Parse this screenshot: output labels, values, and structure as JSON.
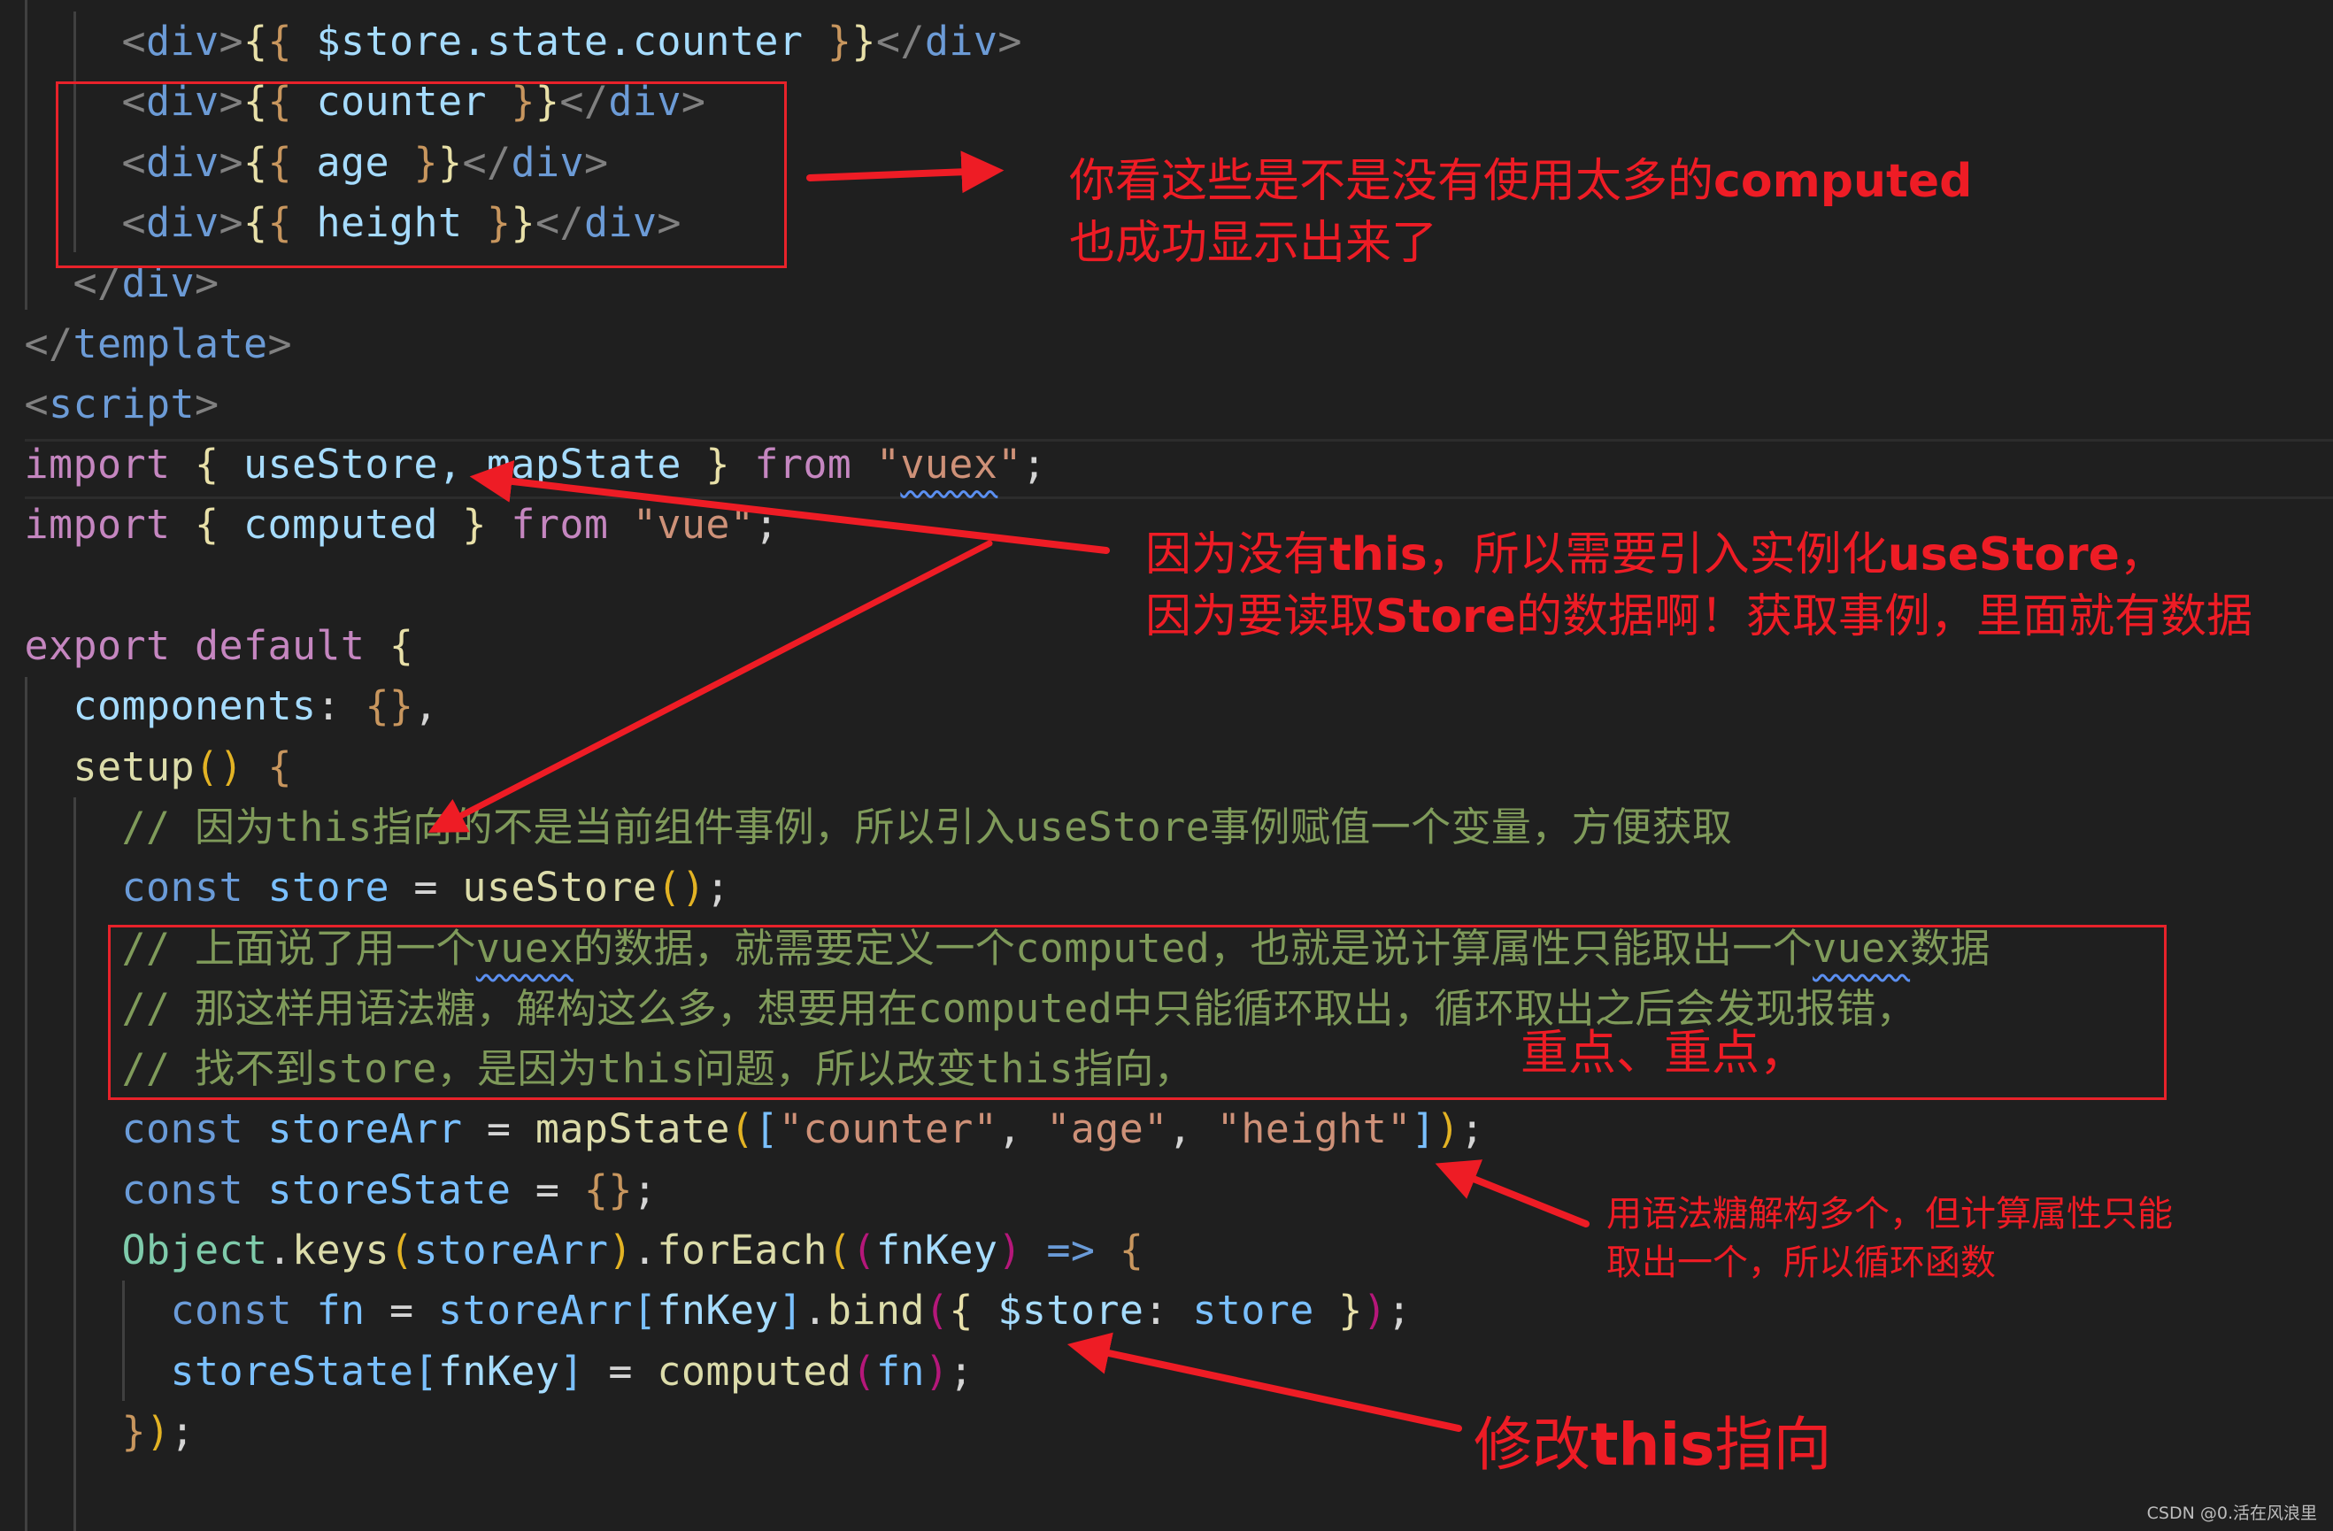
{
  "code": {
    "lines": [
      {
        "indent": 5,
        "tokens": [
          [
            "<",
            "punc"
          ],
          [
            "div",
            "tag"
          ],
          [
            ">",
            "punc"
          ],
          [
            "{",
            "br1"
          ],
          [
            "{",
            "br2"
          ],
          [
            " $store.state.counter ",
            "var"
          ],
          [
            "}",
            "br2"
          ],
          [
            "}",
            "br1"
          ],
          [
            "</",
            "punc"
          ],
          [
            "div",
            "tag"
          ],
          [
            ">",
            "punc"
          ]
        ]
      },
      {
        "indent": 5,
        "tokens": [
          [
            "<",
            "punc"
          ],
          [
            "div",
            "tag"
          ],
          [
            ">",
            "punc"
          ],
          [
            "{",
            "br1"
          ],
          [
            "{",
            "br2"
          ],
          [
            " counter ",
            "var"
          ],
          [
            "}",
            "br2"
          ],
          [
            "}",
            "br1"
          ],
          [
            "</",
            "punc"
          ],
          [
            "div",
            "tag"
          ],
          [
            ">",
            "punc"
          ]
        ]
      },
      {
        "indent": 5,
        "tokens": [
          [
            "<",
            "punc"
          ],
          [
            "div",
            "tag"
          ],
          [
            ">",
            "punc"
          ],
          [
            "{",
            "br1"
          ],
          [
            "{",
            "br2"
          ],
          [
            " age ",
            "var"
          ],
          [
            "}",
            "br2"
          ],
          [
            "}",
            "br1"
          ],
          [
            "</",
            "punc"
          ],
          [
            "div",
            "tag"
          ],
          [
            ">",
            "punc"
          ]
        ]
      },
      {
        "indent": 5,
        "tokens": [
          [
            "<",
            "punc"
          ],
          [
            "div",
            "tag"
          ],
          [
            ">",
            "punc"
          ],
          [
            "{",
            "br1"
          ],
          [
            "{",
            "br2"
          ],
          [
            " height ",
            "var"
          ],
          [
            "}",
            "br2"
          ],
          [
            "}",
            "br1"
          ],
          [
            "</",
            "punc"
          ],
          [
            "div",
            "tag"
          ],
          [
            ">",
            "punc"
          ]
        ]
      },
      {
        "indent": 3,
        "tokens": [
          [
            "</",
            "punc"
          ],
          [
            "div",
            "tag"
          ],
          [
            ">",
            "punc"
          ]
        ]
      },
      {
        "indent": 1,
        "tokens": [
          [
            "</",
            "punc"
          ],
          [
            "template",
            "tag"
          ],
          [
            ">",
            "punc"
          ]
        ]
      },
      {
        "indent": 1,
        "tokens": [
          [
            "<",
            "punc"
          ],
          [
            "script",
            "tag"
          ],
          [
            ">",
            "punc"
          ]
        ]
      },
      {
        "indent": 1,
        "tokens": [
          [
            "import",
            "kw"
          ],
          [
            " ",
            "plain"
          ],
          [
            "{",
            "br1"
          ],
          [
            " useStore, mapState ",
            "var"
          ],
          [
            "}",
            "br1"
          ],
          [
            " ",
            "plain"
          ],
          [
            "from",
            "kw"
          ],
          [
            " ",
            "plain"
          ],
          [
            "\"",
            "str"
          ],
          [
            "vuex",
            "str sq"
          ],
          [
            "\"",
            "str"
          ],
          [
            ";",
            "plain"
          ]
        ]
      },
      {
        "indent": 1,
        "tokens": [
          [
            "import",
            "kw"
          ],
          [
            " ",
            "plain"
          ],
          [
            "{",
            "br1"
          ],
          [
            " computed ",
            "var"
          ],
          [
            "}",
            "br1"
          ],
          [
            " ",
            "plain"
          ],
          [
            "from",
            "kw"
          ],
          [
            " ",
            "plain"
          ],
          [
            "\"vue\"",
            "str"
          ],
          [
            ";",
            "plain"
          ]
        ]
      },
      {
        "indent": 1,
        "tokens": []
      },
      {
        "indent": 1,
        "tokens": [
          [
            "export",
            "kw"
          ],
          [
            " ",
            "plain"
          ],
          [
            "default",
            "kw"
          ],
          [
            " ",
            "plain"
          ],
          [
            "{",
            "br1"
          ]
        ]
      },
      {
        "indent": 3,
        "tokens": [
          [
            "components",
            "var"
          ],
          [
            ": ",
            "plain"
          ],
          [
            "{}",
            "br2"
          ],
          [
            ",",
            "plain"
          ]
        ]
      },
      {
        "indent": 3,
        "tokens": [
          [
            "setup",
            "fn"
          ],
          [
            "(",
            "br3"
          ],
          [
            ")",
            "br3"
          ],
          [
            " ",
            "plain"
          ],
          [
            "{",
            "br2"
          ]
        ]
      },
      {
        "indent": 5,
        "tokens": [
          [
            "// 因为this指向的不是当前组件事例，所以引入useStore事例赋值一个变量，方便获取",
            "cmt"
          ]
        ]
      },
      {
        "indent": 5,
        "tokens": [
          [
            "const",
            "decl"
          ],
          [
            " ",
            "plain"
          ],
          [
            "store",
            "const"
          ],
          [
            " = ",
            "plain"
          ],
          [
            "useStore",
            "fn"
          ],
          [
            "(",
            "br3"
          ],
          [
            ")",
            "br3"
          ],
          [
            ";",
            "plain"
          ]
        ]
      },
      {
        "indent": 5,
        "tokens": [
          [
            "// 上面说了用一个",
            "cmt"
          ],
          [
            "vuex",
            "cmt sq"
          ],
          [
            "的数据，就需要定义一个computed，也就是说计算属性只能取出一个",
            "cmt"
          ],
          [
            "vuex",
            "cmt sq"
          ],
          [
            "数据",
            "cmt"
          ]
        ]
      },
      {
        "indent": 5,
        "tokens": [
          [
            "// 那这样用语法糖，解构这么多，想要用在computed中只能循环取出，循环取出之后会发现报错，",
            "cmt"
          ]
        ]
      },
      {
        "indent": 5,
        "tokens": [
          [
            "// 找不到store，是因为this问题，所以改变this指向，",
            "cmt"
          ]
        ]
      },
      {
        "indent": 5,
        "tokens": [
          [
            "const",
            "decl"
          ],
          [
            " ",
            "plain"
          ],
          [
            "storeArr",
            "const"
          ],
          [
            " = ",
            "plain"
          ],
          [
            "mapState",
            "fn"
          ],
          [
            "(",
            "br3"
          ],
          [
            "[",
            "const"
          ],
          [
            "\"counter\"",
            "str"
          ],
          [
            ", ",
            "plain"
          ],
          [
            "\"age\"",
            "str"
          ],
          [
            ", ",
            "plain"
          ],
          [
            "\"height\"",
            "str"
          ],
          [
            "]",
            "const"
          ],
          [
            ")",
            "br3"
          ],
          [
            ";",
            "plain"
          ]
        ]
      },
      {
        "indent": 5,
        "tokens": [
          [
            "const",
            "decl"
          ],
          [
            " ",
            "plain"
          ],
          [
            "storeState",
            "const"
          ],
          [
            " = ",
            "plain"
          ],
          [
            "{}",
            "br2"
          ],
          [
            ";",
            "plain"
          ]
        ]
      },
      {
        "indent": 5,
        "tokens": [
          [
            "Object",
            "cls"
          ],
          [
            ".",
            "plain"
          ],
          [
            "keys",
            "fn"
          ],
          [
            "(",
            "br3"
          ],
          [
            "storeArr",
            "const"
          ],
          [
            ")",
            "br3"
          ],
          [
            ".",
            "plain"
          ],
          [
            "forEach",
            "fn"
          ],
          [
            "(",
            "br3"
          ],
          [
            "(",
            "br4"
          ],
          [
            "fnKey",
            "var"
          ],
          [
            ")",
            "br4"
          ],
          [
            " ",
            "plain"
          ],
          [
            "=>",
            "decl"
          ],
          [
            " ",
            "plain"
          ],
          [
            "{",
            "br2"
          ]
        ]
      },
      {
        "indent": 7,
        "tokens": [
          [
            "const",
            "decl"
          ],
          [
            " ",
            "plain"
          ],
          [
            "fn",
            "const"
          ],
          [
            " = ",
            "plain"
          ],
          [
            "storeArr",
            "const"
          ],
          [
            "[",
            "const"
          ],
          [
            "fnKey",
            "var"
          ],
          [
            "]",
            "const"
          ],
          [
            ".",
            "plain"
          ],
          [
            "bind",
            "fn"
          ],
          [
            "(",
            "br4"
          ],
          [
            "{",
            "br1"
          ],
          [
            " $store",
            "var"
          ],
          [
            ": ",
            "plain"
          ],
          [
            "store",
            "const"
          ],
          [
            " ",
            "plain"
          ],
          [
            "}",
            "br1"
          ],
          [
            ")",
            "br4"
          ],
          [
            ";",
            "plain"
          ]
        ]
      },
      {
        "indent": 7,
        "tokens": [
          [
            "storeState",
            "const"
          ],
          [
            "[",
            "const"
          ],
          [
            "fnKey",
            "var"
          ],
          [
            "]",
            "const"
          ],
          [
            " = ",
            "plain"
          ],
          [
            "computed",
            "fn"
          ],
          [
            "(",
            "br4"
          ],
          [
            "fn",
            "const"
          ],
          [
            ")",
            "br4"
          ],
          [
            ";",
            "plain"
          ]
        ]
      },
      {
        "indent": 5,
        "tokens": [
          [
            "}",
            "br2"
          ],
          [
            ")",
            "br3"
          ],
          [
            ";",
            "plain"
          ]
        ]
      }
    ]
  },
  "annotations": {
    "note1": {
      "line1_a": "你看这些是不是没有使用太多的",
      "line1_b": "computed",
      "line2": "也成功显示出来了"
    },
    "note2": {
      "l1_a": "因为没有",
      "l1_b": "this",
      "l1_c": "，所以需要引入实例化",
      "l1_d": "useStore",
      "l1_e": "，",
      "l2_a": "因为要读取",
      "l2_b": "Store",
      "l2_c": "的数据啊！获取事例，里面就有数据"
    },
    "note3": "重点、重点，",
    "note4": {
      "line1": "用语法糖解构多个，但计算属性只能",
      "line2": "取出一个，所以循环函数"
    },
    "note5": {
      "a": "修改",
      "b": "this",
      "c": "指向"
    }
  },
  "colors": {
    "annotation": "#ee1c25",
    "background": "#1f1f1f"
  },
  "watermark": "CSDN @0.活在风浪里"
}
